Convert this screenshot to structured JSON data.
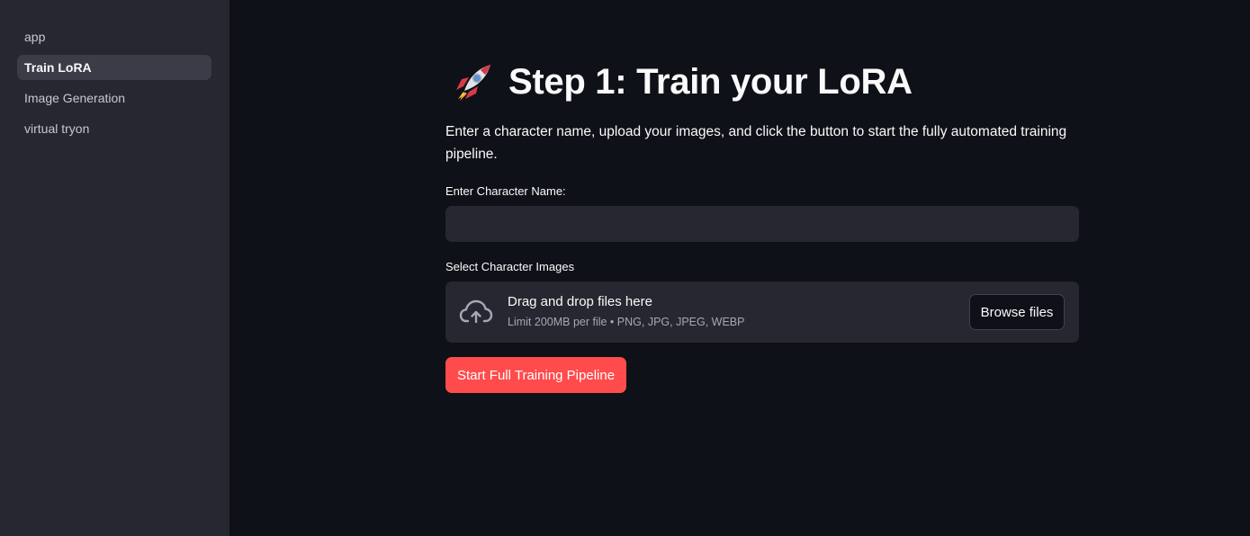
{
  "sidebar": {
    "items": [
      {
        "label": "app",
        "active": false
      },
      {
        "label": "Train LoRA",
        "active": true
      },
      {
        "label": "Image Generation",
        "active": false
      },
      {
        "label": "virtual tryon",
        "active": false
      }
    ]
  },
  "main": {
    "title_icon": "rocket-emoji",
    "title": "Step 1: Train your LoRA",
    "intro": "Enter a character name, upload your images, and click the button to start the fully automated training pipeline.",
    "name_field": {
      "label": "Enter Character Name:",
      "value": "",
      "placeholder": ""
    },
    "uploader": {
      "label": "Select Character Images",
      "icon": "cloud-upload-icon",
      "title": "Drag and drop files here",
      "subtitle": "Limit 200MB per file • PNG, JPG, JPEG, WEBP",
      "browse_label": "Browse files"
    },
    "start_button_label": "Start Full Training Pipeline"
  },
  "colors": {
    "background": "#0e1117",
    "sidebar": "#262730",
    "sidebar_active": "#3b3c48",
    "input_bg": "#262730",
    "primary": "#ff4b4b",
    "text": "#fafafa",
    "muted_text": "#a3a8b8"
  }
}
